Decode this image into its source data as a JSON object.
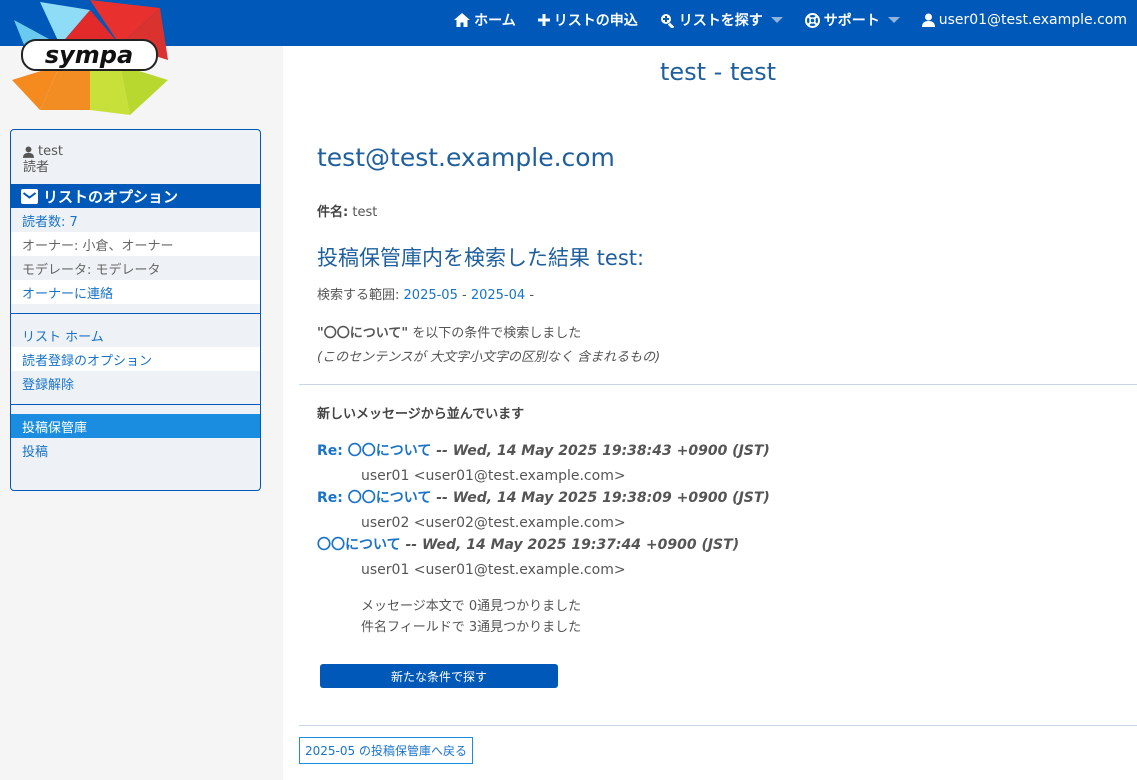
{
  "logo": {
    "text": "sympa"
  },
  "nav": {
    "home": "ホーム",
    "request_list": "リストの申込",
    "search_lists": "リストを探す",
    "support": "サポート",
    "user": "user01@test.example.com"
  },
  "sidebar": {
    "list_name": "test",
    "role": "読者",
    "options_title": "リストのオプション",
    "subscribers": "読者数: 7",
    "owners": "オーナー: 小倉、オーナー",
    "moderators": "モデレータ: モデレータ",
    "contact_owners": "オーナーに連絡",
    "list_home": "リスト ホーム",
    "subscriber_options": "読者登録のオプション",
    "unsubscribe": "登録解除",
    "archives": "投稿保管庫",
    "post": "投稿"
  },
  "main": {
    "page_title": "test - test",
    "list_address": "test@test.example.com",
    "subject_label": "件名:",
    "subject_value": "test",
    "result_heading": "投稿保管庫内を検索した結果 test:",
    "range_label": "検索する範囲:",
    "range_from": "2025-05",
    "range_sep": "-",
    "range_to": "2025-04",
    "range_tail": "-",
    "query_quoted": "\"〇〇について\"",
    "query_desc": "を以下の条件で検索しました",
    "query_cond": "(このセンテンスが 大文字小文字の区別なく 含まれるもの)",
    "sort_note": "新しいメッセージから並んでいます",
    "messages": [
      {
        "subject": "Re: 〇〇について",
        "date": "-- Wed, 14 May 2025 19:38:43 +0900 (JST)",
        "sender": "user01 <user01@test.example.com>"
      },
      {
        "subject": "Re: 〇〇について",
        "date": "-- Wed, 14 May 2025 19:38:09 +0900 (JST)",
        "sender": "user02 <user02@test.example.com>"
      },
      {
        "subject": "〇〇について",
        "date": "-- Wed, 14 May 2025 19:37:44 +0900 (JST)",
        "sender": "user01 <user01@test.example.com>"
      }
    ],
    "found_body": "メッセージ本文で 0通見つかりました",
    "found_subject": "件名フィールドで 3通見つかりました",
    "new_search_button": "新たな条件で探す",
    "back_button": "2025-05 の投稿保管庫へ戻る"
  },
  "colors": {
    "brand": "#0058b8",
    "link": "#1a73c9",
    "active": "#1a8de0"
  }
}
